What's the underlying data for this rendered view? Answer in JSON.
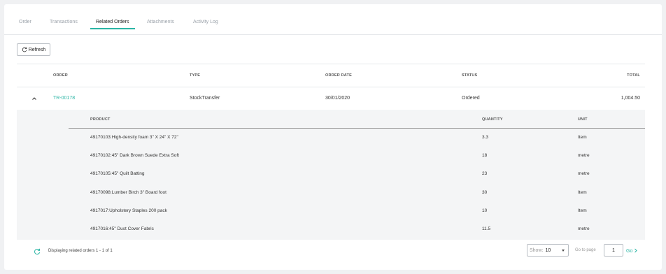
{
  "tabs": [
    {
      "label": "Order"
    },
    {
      "label": "Transactions"
    },
    {
      "label": "Related Orders",
      "active": true
    },
    {
      "label": "Attachments"
    },
    {
      "label": "Activity Log"
    }
  ],
  "toolbar": {
    "refresh_label": "Refresh"
  },
  "table": {
    "headers": {
      "order": "ORDER",
      "type": "TYPE",
      "order_date": "ORDER DATE",
      "status": "STATUS",
      "total": "TOTAL"
    },
    "rows": [
      {
        "order": "TR-00178",
        "type": "StockTransfer",
        "order_date": "30/01/2020",
        "status": "Ordered",
        "total": "1,004.50",
        "expanded": true
      }
    ]
  },
  "subtable": {
    "headers": {
      "product": "PRODUCT",
      "quantity": "QUANTITY",
      "unit": "UNIT"
    },
    "rows": [
      {
        "product": "49170103:High-density foam 3\" X 24\" X 72\"",
        "quantity": "3.3",
        "unit": "Item"
      },
      {
        "product": "49170102:45\" Dark Brown Suede Extra Soft",
        "quantity": "18",
        "unit": "metre"
      },
      {
        "product": "49170105:45\" Quilt Batting",
        "quantity": "23",
        "unit": "metre"
      },
      {
        "product": "49170098:Lumber Birch 3\" Board foot",
        "quantity": "30",
        "unit": "Item"
      },
      {
        "product": "4917017:Upholstery Staples 200 pack",
        "quantity": "10",
        "unit": "Item"
      },
      {
        "product": "4917016:45\" Dust Cover Fabric",
        "quantity": "11.5",
        "unit": "metre"
      }
    ]
  },
  "footer": {
    "status_text": "Displaying related orders 1 - 1 of 1",
    "show_label": "Show:",
    "show_value": "10",
    "goto_label": "Go to page",
    "goto_value": "1",
    "go_label": "Go"
  },
  "colors": {
    "accent": "#2bb5a5",
    "background": "#f0f1f3"
  },
  "icons": {
    "refresh": "refresh-icon",
    "collapse": "chevron-up-icon",
    "footer_refresh": "refresh-icon",
    "go": "chevron-right-icon",
    "select": "caret-down-icon"
  }
}
